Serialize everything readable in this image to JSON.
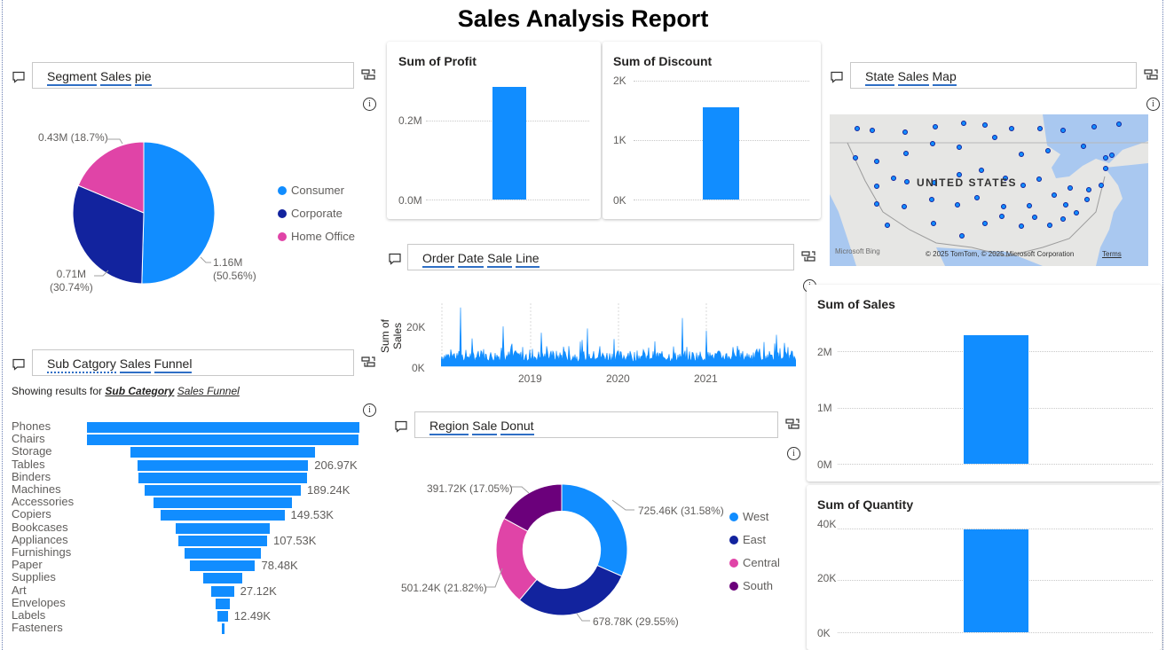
{
  "report": {
    "title": "Sales Analysis Report"
  },
  "qa": {
    "segment": [
      "Segment",
      "Sales",
      "pie"
    ],
    "subcat": [
      "Sub Catgory",
      "Sales",
      "Funnel"
    ],
    "orderdate": [
      "Order",
      "Date",
      "Sale",
      "Line"
    ],
    "region": [
      "Region",
      "Sale",
      "Donut"
    ],
    "statemap": [
      "State",
      "Sales",
      "Map"
    ]
  },
  "showing_results": {
    "prefix": "Showing results for",
    "bold": "Sub Category",
    "rest": "Sales Funnel"
  },
  "segment_pie": {
    "legend": [
      "Consumer",
      "Corporate",
      "Home Office"
    ],
    "colors": [
      "#118dff",
      "#12239e",
      "#e044a7"
    ],
    "values": [
      1.16,
      0.71,
      0.43
    ],
    "labels": [
      [
        "1.16M",
        "(50.56%)"
      ],
      [
        "0.71M",
        "(30.74%)"
      ],
      [
        "0.43M (18.7%)"
      ]
    ]
  },
  "profit_card": {
    "title": "Sum of Profit",
    "ticks": [
      "0.2M",
      "0.0M"
    ]
  },
  "discount_card": {
    "title": "Sum of Discount",
    "ticks": [
      "2K",
      "1K",
      "0K"
    ]
  },
  "sales_card": {
    "title": "Sum of Sales",
    "ticks": [
      "2M",
      "1M",
      "0M"
    ]
  },
  "quantity_card": {
    "title": "Sum of Quantity",
    "ticks": [
      "40K",
      "20K",
      "0K"
    ]
  },
  "order_line": {
    "ylabel": "Sum of Sales",
    "yticks": [
      "20K",
      "0K"
    ],
    "xticks": [
      "2019",
      "2020",
      "2021"
    ]
  },
  "funnel": {
    "categories": [
      "Phones",
      "Chairs",
      "Storage",
      "Tables",
      "Binders",
      "Machines",
      "Accessories",
      "Copiers",
      "Bookcases",
      "Appliances",
      "Furnishings",
      "Paper",
      "Supplies",
      "Art",
      "Envelopes",
      "Labels",
      "Fasteners"
    ],
    "value_labels": [
      "",
      "",
      "",
      "206.97K",
      "",
      "189.24K",
      "",
      "149.53K",
      "",
      "107.53K",
      "",
      "78.48K",
      "",
      "27.12K",
      "",
      "12.49K",
      ""
    ]
  },
  "region_donut": {
    "legend": [
      "West",
      "East",
      "Central",
      "South"
    ],
    "colors": [
      "#118dff",
      "#12239e",
      "#e044a7",
      "#6b007b"
    ],
    "labels": [
      "725.46K (31.58%)",
      "678.78K (29.55%)",
      "501.24K (21.82%)",
      "391.72K (17.05%)"
    ]
  },
  "map": {
    "country_label": "UNITED STATES",
    "provider": "Microsoft Bing",
    "copyright": "© 2025 TomTom, © 2025 Microsoft Corporation",
    "terms": "Terms"
  },
  "chart_data": [
    {
      "type": "pie",
      "title": "",
      "categories": [
        "Consumer",
        "Corporate",
        "Home Office"
      ],
      "values": [
        1.16,
        0.71,
        0.43
      ],
      "unit": "M"
    },
    {
      "type": "bar",
      "title": "Sum of Profit",
      "categories": [
        ""
      ],
      "values": [
        0.29
      ],
      "unit": "M",
      "ylim": [
        0,
        0.3
      ]
    },
    {
      "type": "bar",
      "title": "Sum of Discount",
      "categories": [
        ""
      ],
      "values": [
        1560
      ],
      "ylim": [
        0,
        2000
      ]
    },
    {
      "type": "bar",
      "title": "Sum of Sales",
      "categories": [
        ""
      ],
      "values": [
        2300000
      ],
      "ylim": [
        0,
        2500000
      ]
    },
    {
      "type": "bar",
      "title": "Sum of Quantity",
      "categories": [
        ""
      ],
      "values": [
        37900
      ],
      "ylim": [
        0,
        40000
      ]
    },
    {
      "type": "line",
      "ylabel": "Sum of Sales",
      "xticks": [
        "2019",
        "2020",
        "2021"
      ],
      "ylim": [
        0,
        30000
      ]
    },
    {
      "type": "bar",
      "title": "",
      "categories": [
        "Phones",
        "Chairs",
        "Storage",
        "Tables",
        "Binders",
        "Machines",
        "Accessories",
        "Copiers",
        "Bookcases",
        "Appliances",
        "Furnishings",
        "Paper",
        "Supplies",
        "Art",
        "Envelopes",
        "Labels",
        "Fasteners"
      ],
      "values": [
        330.01,
        328.45,
        223.84,
        206.97,
        203.41,
        189.24,
        167.38,
        149.53,
        114.88,
        107.53,
        91.71,
        78.48,
        46.67,
        27.12,
        16.48,
        12.49,
        3.02
      ],
      "unit": "K"
    },
    {
      "type": "pie",
      "title": "",
      "categories": [
        "West",
        "East",
        "Central",
        "South"
      ],
      "values": [
        725.46,
        678.78,
        501.24,
        391.72
      ],
      "unit": "K"
    }
  ]
}
